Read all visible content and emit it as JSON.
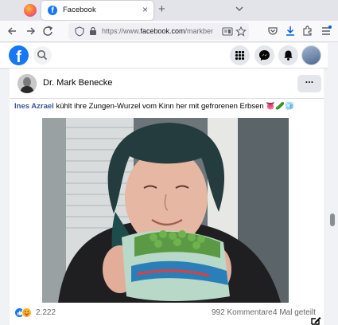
{
  "browser": {
    "tab": {
      "title": "Facebook",
      "close_glyph": "×"
    },
    "new_tab_glyph": "+",
    "url": {
      "prefix": "https://www.",
      "domain": "facebook.com",
      "suffix": "/markbenecke"
    },
    "icons": [
      "firefox-icon",
      "back-icon",
      "forward-icon",
      "reload-icon",
      "shield-icon",
      "lock-icon",
      "reader-icon",
      "bookmark-star-icon",
      "pocket-icon",
      "download-icon",
      "extensions-icon",
      "menu-icon"
    ]
  },
  "facebook": {
    "logo_letter": "f",
    "header_icons": [
      "search-icon",
      "apps-grid-icon",
      "messenger-icon",
      "notifications-bell-icon",
      "profile-avatar"
    ]
  },
  "post": {
    "author": "Dr. Mark Benecke",
    "more_glyph": "···",
    "caption": {
      "mention": "Ines Azrael",
      "text": " kühlt ihre Zungen-Wurzel vom Kinn her mit gefrorenen Erbsen ",
      "emoji": "👅🥒🧊"
    },
    "reaction_count": "2.222",
    "comments": "992 Kommentare",
    "shares": "4 Mal geteilt"
  },
  "colors": {
    "facebook_blue": "#1877f2",
    "mention_blue": "#385898",
    "secondary_text": "#65676b",
    "page_bg": "#f0f2f5"
  }
}
